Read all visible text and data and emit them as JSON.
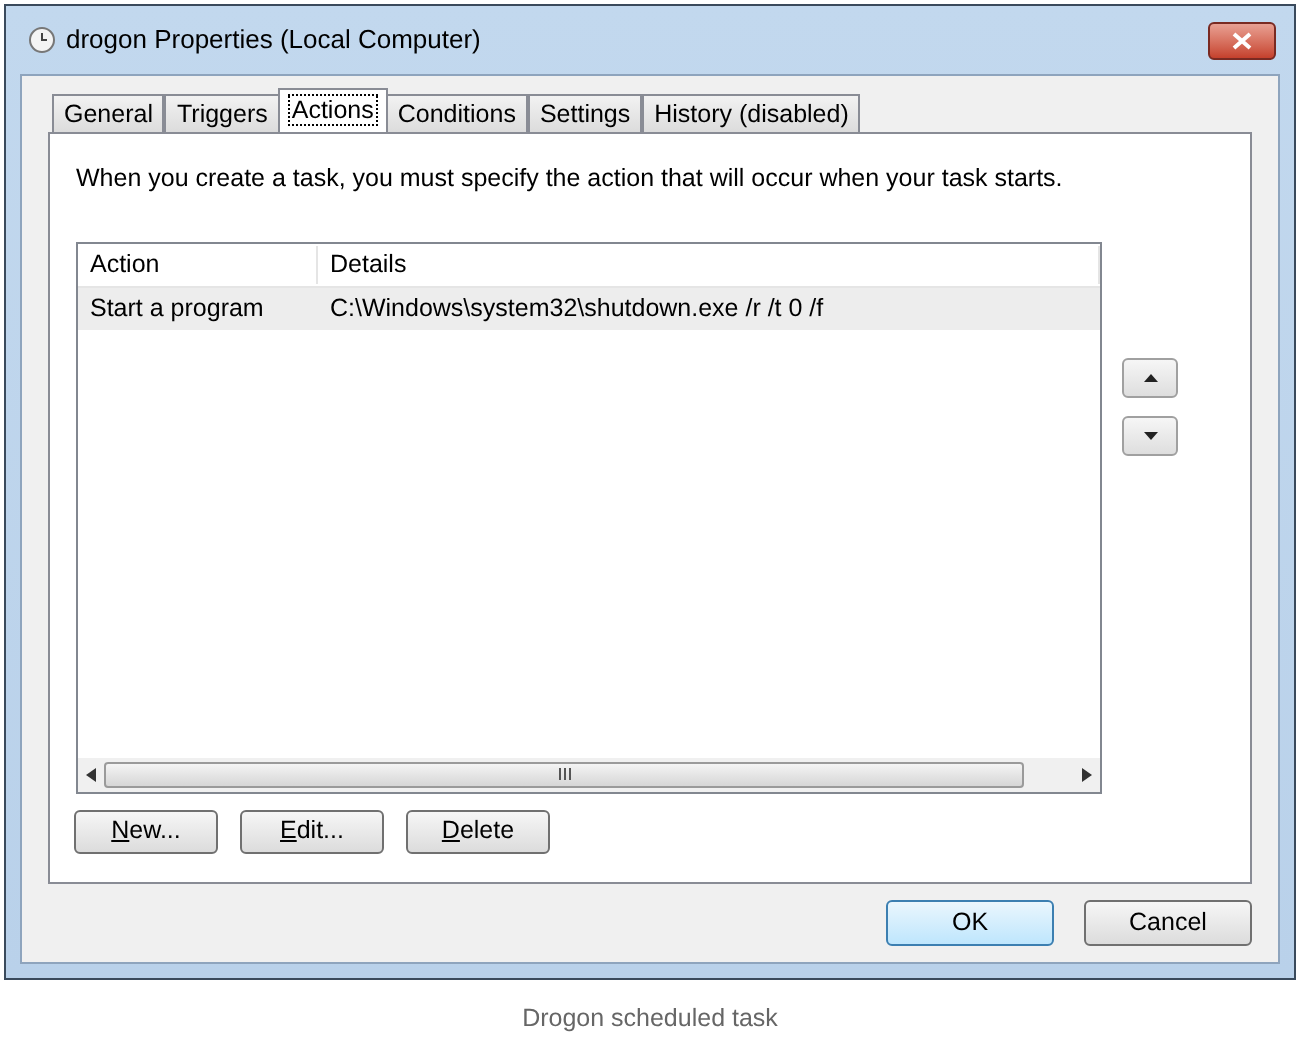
{
  "window": {
    "title": "drogon Properties (Local Computer)"
  },
  "tabs": [
    {
      "label": "General",
      "selected": false
    },
    {
      "label": "Triggers",
      "selected": false
    },
    {
      "label": "Actions",
      "selected": true
    },
    {
      "label": "Conditions",
      "selected": false
    },
    {
      "label": "Settings",
      "selected": false
    },
    {
      "label": "History (disabled)",
      "selected": false
    }
  ],
  "description": "When you create a task, you must specify the action that will occur when your task starts.",
  "table": {
    "columns": [
      "Action",
      "Details"
    ],
    "rows": [
      {
        "cells": [
          "Start a program",
          "C:\\Windows\\system32\\shutdown.exe /r /t 0 /f"
        ],
        "selected": true
      }
    ]
  },
  "action_buttons": [
    {
      "access_key": "N",
      "label_rest": "ew..."
    },
    {
      "access_key": "E",
      "label_rest": "dit..."
    },
    {
      "access_key": "D",
      "label_rest": "elete"
    }
  ],
  "dialog_buttons": [
    {
      "label": "OK",
      "default": true
    },
    {
      "label": "Cancel",
      "default": false
    }
  ],
  "caption": "Drogon scheduled task"
}
